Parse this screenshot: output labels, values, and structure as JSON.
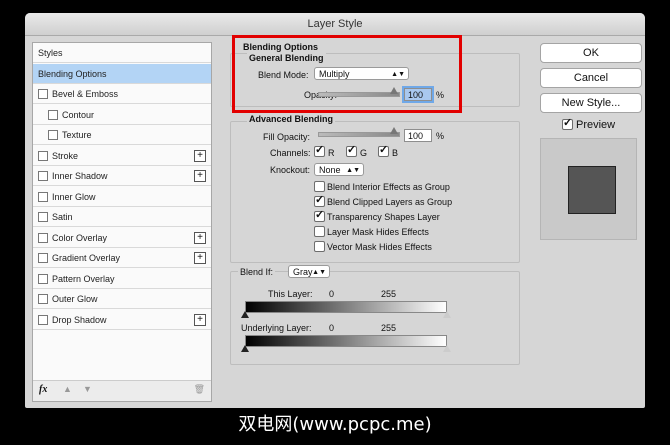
{
  "window": {
    "title": "Layer Style"
  },
  "sidebar": {
    "items": [
      {
        "label": "Styles",
        "checkbox": false,
        "plus": false
      },
      {
        "label": "Blending Options",
        "checkbox": false,
        "plus": false,
        "selected": true
      },
      {
        "label": "Bevel & Emboss",
        "checkbox": true,
        "plus": false
      },
      {
        "label": "Contour",
        "checkbox": true,
        "plus": false,
        "indent": true
      },
      {
        "label": "Texture",
        "checkbox": true,
        "plus": false,
        "indent": true
      },
      {
        "label": "Stroke",
        "checkbox": true,
        "plus": true
      },
      {
        "label": "Inner Shadow",
        "checkbox": true,
        "plus": true
      },
      {
        "label": "Inner Glow",
        "checkbox": true,
        "plus": false
      },
      {
        "label": "Satin",
        "checkbox": true,
        "plus": false
      },
      {
        "label": "Color Overlay",
        "checkbox": true,
        "plus": true
      },
      {
        "label": "Gradient Overlay",
        "checkbox": true,
        "plus": true
      },
      {
        "label": "Pattern Overlay",
        "checkbox": true,
        "plus": false
      },
      {
        "label": "Outer Glow",
        "checkbox": true,
        "plus": false
      },
      {
        "label": "Drop Shadow",
        "checkbox": true,
        "plus": true
      }
    ],
    "footer": {
      "fx_label": "fx"
    }
  },
  "blending": {
    "section_title": "Blending Options",
    "general_title": "General Blending",
    "blend_mode_label": "Blend Mode:",
    "blend_mode_value": "Multiply",
    "opacity_label": "Opacity:",
    "opacity_value": "100",
    "percent": "%"
  },
  "advanced": {
    "title": "Advanced Blending",
    "fill_label": "Fill Opacity:",
    "fill_value": "100",
    "percent": "%",
    "channels_label": "Channels:",
    "channels": [
      {
        "label": "R",
        "checked": true
      },
      {
        "label": "G",
        "checked": true
      },
      {
        "label": "B",
        "checked": true
      }
    ],
    "knockout_label": "Knockout:",
    "knockout_value": "None",
    "options": [
      {
        "label": "Blend Interior Effects as Group",
        "checked": false
      },
      {
        "label": "Blend Clipped Layers as Group",
        "checked": true
      },
      {
        "label": "Transparency Shapes Layer",
        "checked": true
      },
      {
        "label": "Layer Mask Hides Effects",
        "checked": false
      },
      {
        "label": "Vector Mask Hides Effects",
        "checked": false
      }
    ]
  },
  "blend_if": {
    "label": "Blend If:",
    "value": "Gray",
    "this_layer_label": "This Layer:",
    "this_low": "0",
    "this_high": "255",
    "underlying_label": "Underlying Layer:",
    "under_low": "0",
    "under_high": "255"
  },
  "buttons": {
    "ok": "OK",
    "cancel": "Cancel",
    "new_style": "New Style...",
    "preview": "Preview"
  },
  "watermark": "双电网(www.pcpc.me)",
  "colors": {
    "highlight": "#e20000",
    "selection": "#b3d4f5"
  }
}
